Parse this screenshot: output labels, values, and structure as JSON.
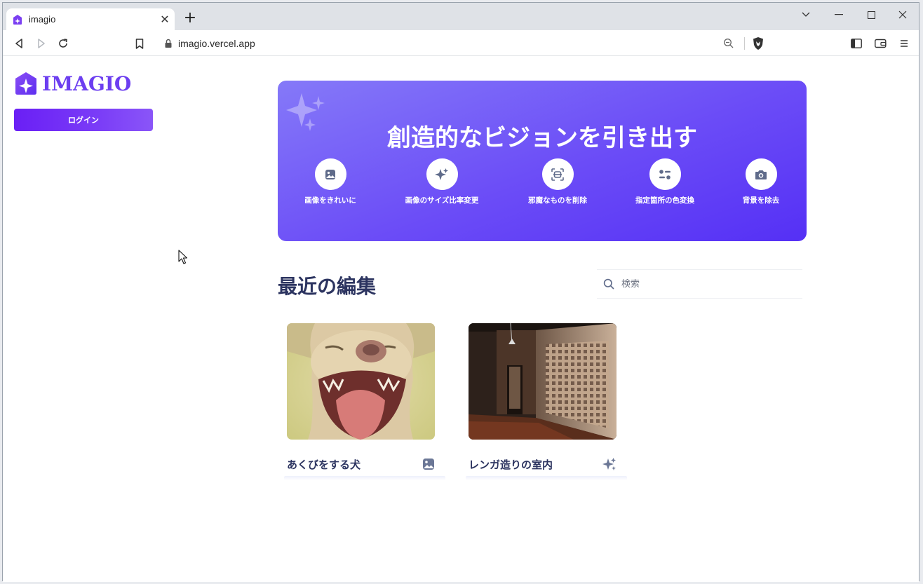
{
  "browser": {
    "tab_title": "imagio",
    "url": "imagio.vercel.app"
  },
  "app": {
    "logo_text": "IMAGIO",
    "login_label": "ログイン",
    "accent_color": "#6a1ff5"
  },
  "hero": {
    "title": "創造的なビジョンを引き出す",
    "features": [
      {
        "label": "画像をきれいに",
        "icon": "image-icon"
      },
      {
        "label": "画像のサイズ比率変更",
        "icon": "sparkles-icon"
      },
      {
        "label": "邪魔なものを削除",
        "icon": "scan-remove-icon"
      },
      {
        "label": "指定箇所の色変換",
        "icon": "color-adjust-icon"
      },
      {
        "label": "背景を除去",
        "icon": "camera-icon"
      }
    ]
  },
  "recent": {
    "title": "最近の編集",
    "search_placeholder": "検索",
    "items": [
      {
        "name": "あくびをする犬",
        "type_icon": "image-icon"
      },
      {
        "name": "レンガ造りの室内",
        "type_icon": "sparkles-icon"
      }
    ]
  }
}
